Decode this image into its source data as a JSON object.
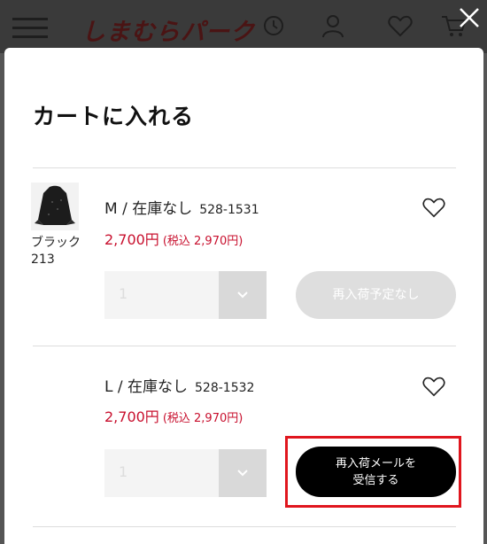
{
  "header": {
    "logo_text": "しまむらパーク",
    "icons": [
      "menu-icon",
      "history-icon",
      "user-icon",
      "heart-icon",
      "cart-icon",
      "close-icon"
    ]
  },
  "modal": {
    "title": "カートに入れる",
    "product": {
      "color_name": "ブラック",
      "color_code": "213"
    },
    "variants": [
      {
        "label": "M / 在庫なし",
        "code": "528-1531",
        "price": "2,700円",
        "tax_price": "(税込 2,970円)",
        "quantity": "1",
        "action_label": "再入荷予定なし"
      },
      {
        "label": "L / 在庫なし",
        "code": "528-1532",
        "price": "2,700円",
        "tax_price": "(税込 2,970円)",
        "quantity": "1",
        "action_label_line1": "再入荷メールを",
        "action_label_line2": "受信する"
      }
    ]
  },
  "colors": {
    "price_red": "#c8102e",
    "highlight_red": "#e0161e",
    "overlay_gray": "#555555"
  }
}
